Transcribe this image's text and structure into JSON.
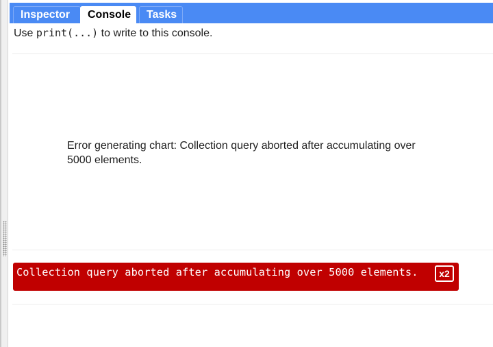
{
  "tabs": {
    "inspector": "Inspector",
    "console": "Console",
    "tasks": "Tasks",
    "active": "Console"
  },
  "console": {
    "hint_before": "Use ",
    "hint_code": "print(...)",
    "hint_after": " to write to this console.",
    "chart_error": "Error generating chart: Collection query aborted after accumulating over 5000 elements.",
    "error_message": "Collection query aborted after accumulating over 5000 elements.",
    "error_count": "x2"
  },
  "colors": {
    "tab_bar": "#4a8af4",
    "error_background": "#c00000",
    "error_text": "#ffffff"
  }
}
